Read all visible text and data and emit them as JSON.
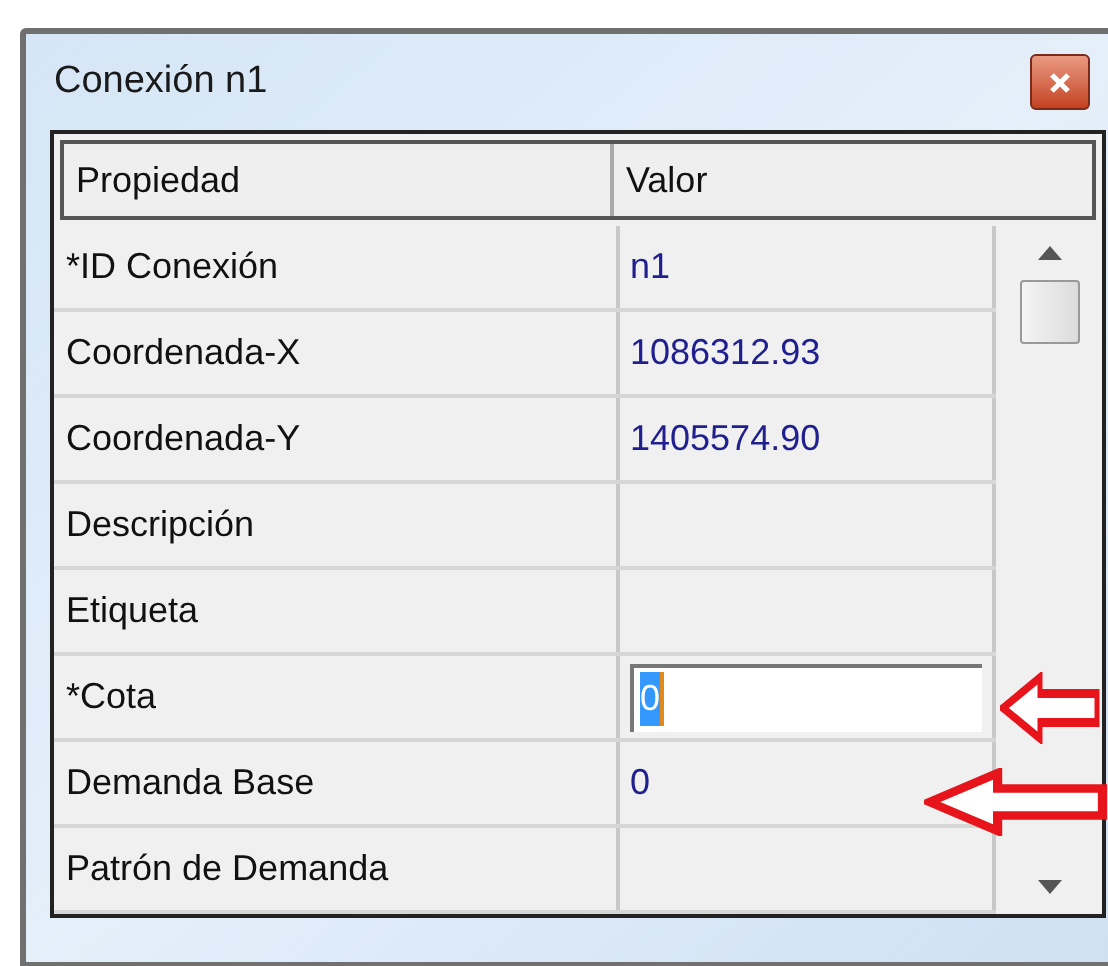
{
  "window": {
    "title": "Conexión n1"
  },
  "table": {
    "columns": [
      "Propiedad",
      "Valor"
    ],
    "rows": [
      {
        "property": "*ID Conexión",
        "value": "n1",
        "kind": "text"
      },
      {
        "property": "Coordenada-X",
        "value": "1086312.93",
        "kind": "text"
      },
      {
        "property": "Coordenada-Y",
        "value": "1405574.90",
        "kind": "text"
      },
      {
        "property": "Descripción",
        "kind": "text"
      },
      {
        "property": "Etiqueta",
        "kind": "text"
      },
      {
        "property": "*Cota",
        "value": "0",
        "kind": "editing"
      },
      {
        "property": "Demanda Base",
        "value": "0",
        "kind": "text"
      },
      {
        "property": "Patrón de Demanda",
        "kind": "text"
      }
    ]
  }
}
